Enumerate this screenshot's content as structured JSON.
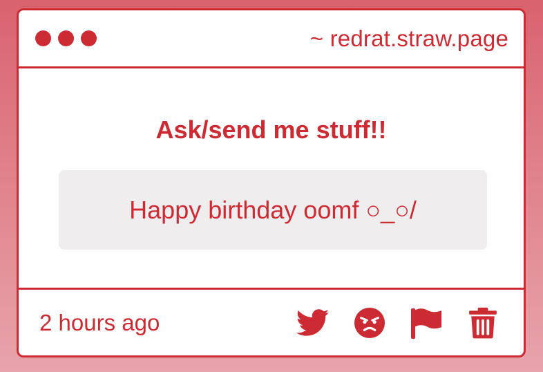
{
  "window": {
    "url": "~ redrat.straw.page"
  },
  "main": {
    "heading": "Ask/send me stuff!!",
    "message": "Happy birthday oomf ○_○/"
  },
  "footer": {
    "timestamp": "2 hours ago",
    "actions": [
      {
        "icon": "twitter-icon"
      },
      {
        "icon": "angry-face-icon"
      },
      {
        "icon": "flag-icon"
      },
      {
        "icon": "trash-icon"
      }
    ]
  },
  "colors": {
    "accent": "#cc2b33",
    "card_bg": "#ffffff",
    "message_bg": "#efedee",
    "page_bg_top": "#d9636f",
    "page_bg_bottom": "#e8a4ab"
  }
}
